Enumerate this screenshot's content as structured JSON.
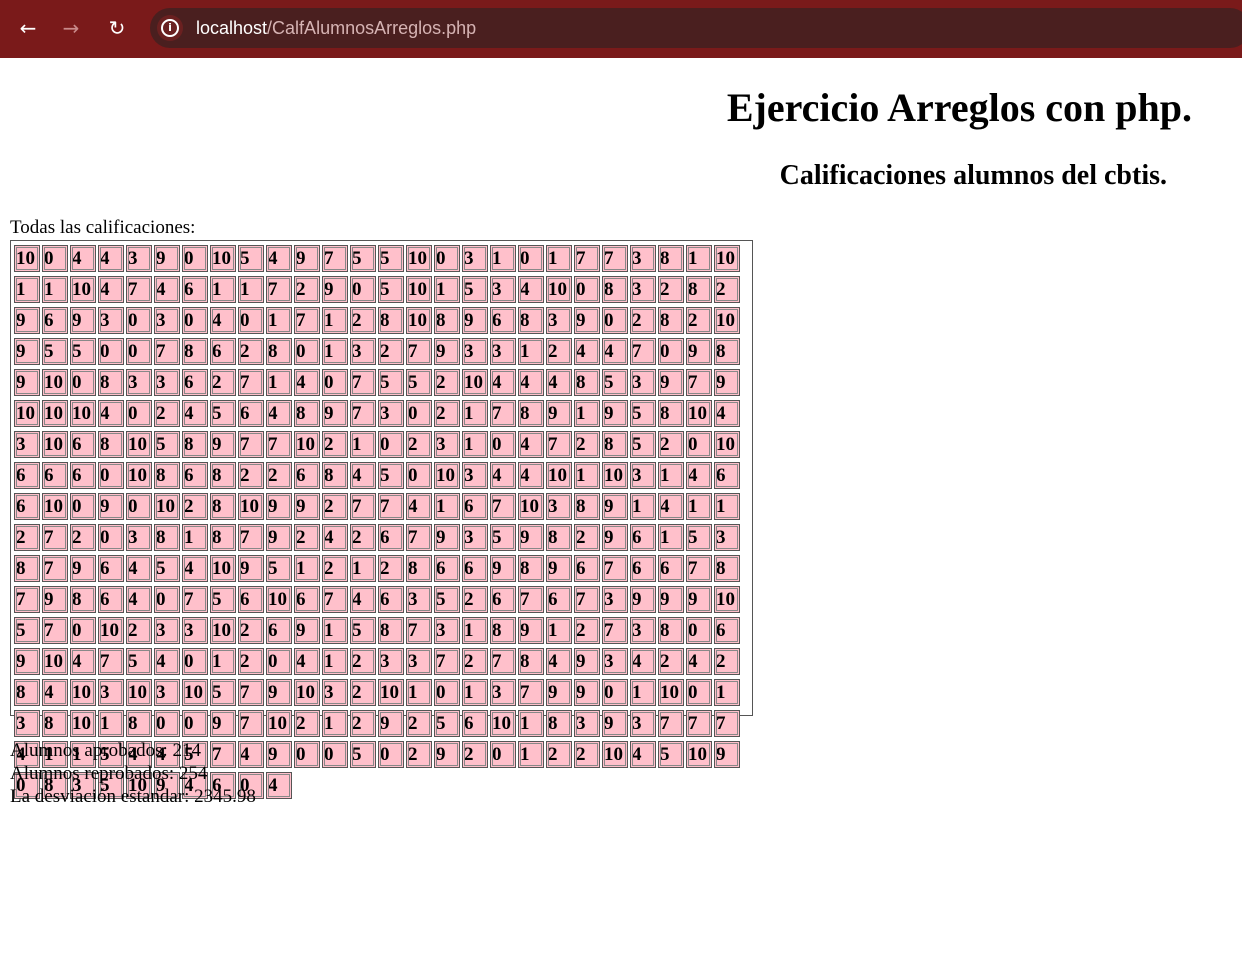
{
  "browser": {
    "url_host": "localhost",
    "url_path": "/CalfAlumnosArreglos.php"
  },
  "page": {
    "title": "Ejercicio Arreglos con php.",
    "subtitle": "Calificaciones alumnos del cbtis.",
    "grades_label": "Todas las calificaciones:",
    "grades": [
      "10",
      "0",
      "4",
      "4",
      "3",
      "9",
      "0",
      "10",
      "5",
      "4",
      "9",
      "7",
      "5",
      "5",
      "10",
      "0",
      "3",
      "1",
      "0",
      "1",
      "7",
      "7",
      "3",
      "8",
      "1",
      "10",
      "1",
      "1",
      "10",
      "4",
      "7",
      "4",
      "6",
      "1",
      "1",
      "7",
      "2",
      "9",
      "0",
      "5",
      "10",
      "1",
      "5",
      "3",
      "4",
      "10",
      "0",
      "8",
      "3",
      "2",
      "8",
      "2",
      "9",
      "6",
      "9",
      "3",
      "0",
      "3",
      "0",
      "4",
      "0",
      "1",
      "7",
      "1",
      "2",
      "8",
      "10",
      "8",
      "9",
      "6",
      "8",
      "3",
      "9",
      "0",
      "2",
      "8",
      "2",
      "10",
      "9",
      "5",
      "5",
      "0",
      "0",
      "7",
      "8",
      "6",
      "2",
      "8",
      "0",
      "1",
      "3",
      "2",
      "7",
      "9",
      "3",
      "3",
      "1",
      "2",
      "4",
      "4",
      "7",
      "0",
      "9",
      "8",
      "9",
      "10",
      "0",
      "8",
      "3",
      "3",
      "6",
      "2",
      "7",
      "1",
      "4",
      "0",
      "7",
      "5",
      "5",
      "2",
      "10",
      "4",
      "4",
      "4",
      "8",
      "5",
      "3",
      "9",
      "7",
      "9",
      "10",
      "10",
      "10",
      "4",
      "0",
      "2",
      "4",
      "5",
      "6",
      "4",
      "8",
      "9",
      "7",
      "3",
      "0",
      "2",
      "1",
      "7",
      "8",
      "9",
      "1",
      "9",
      "5",
      "8",
      "10",
      "4",
      "3",
      "10",
      "6",
      "8",
      "10",
      "5",
      "8",
      "9",
      "7",
      "7",
      "10",
      "2",
      "1",
      "0",
      "2",
      "3",
      "1",
      "0",
      "4",
      "7",
      "2",
      "8",
      "5",
      "2",
      "0",
      "10",
      "6",
      "6",
      "6",
      "0",
      "10",
      "8",
      "6",
      "8",
      "2",
      "2",
      "6",
      "8",
      "4",
      "5",
      "0",
      "10",
      "3",
      "4",
      "4",
      "10",
      "1",
      "10",
      "3",
      "1",
      "4",
      "6",
      "6",
      "10",
      "0",
      "9",
      "0",
      "10",
      "2",
      "8",
      "10",
      "9",
      "9",
      "2",
      "7",
      "7",
      "4",
      "1",
      "6",
      "7",
      "10",
      "3",
      "8",
      "9",
      "1",
      "4",
      "1",
      "1",
      "2",
      "7",
      "2",
      "0",
      "3",
      "8",
      "1",
      "8",
      "7",
      "9",
      "2",
      "4",
      "2",
      "6",
      "7",
      "9",
      "3",
      "5",
      "9",
      "8",
      "2",
      "9",
      "6",
      "1",
      "5",
      "3",
      "8",
      "7",
      "9",
      "6",
      "4",
      "5",
      "4",
      "10",
      "9",
      "5",
      "1",
      "2",
      "1",
      "2",
      "8",
      "6",
      "6",
      "9",
      "8",
      "9",
      "6",
      "7",
      "6",
      "6",
      "7",
      "8",
      "7",
      "9",
      "8",
      "6",
      "4",
      "0",
      "7",
      "5",
      "6",
      "10",
      "6",
      "7",
      "4",
      "6",
      "3",
      "5",
      "2",
      "6",
      "7",
      "6",
      "7",
      "3",
      "9",
      "9",
      "9",
      "10",
      "5",
      "7",
      "0",
      "10",
      "2",
      "3",
      "3",
      "10",
      "2",
      "6",
      "9",
      "1",
      "5",
      "8",
      "7",
      "3",
      "1",
      "8",
      "9",
      "1",
      "2",
      "7",
      "3",
      "8",
      "0",
      "6",
      "9",
      "10",
      "4",
      "7",
      "5",
      "4",
      "0",
      "1",
      "2",
      "0",
      "4",
      "1",
      "2",
      "3",
      "3",
      "7",
      "2",
      "7",
      "8",
      "4",
      "9",
      "3",
      "4",
      "2",
      "4",
      "2",
      "8",
      "4",
      "10",
      "3",
      "10",
      "3",
      "10",
      "5",
      "7",
      "9",
      "10",
      "3",
      "2",
      "10",
      "1",
      "0",
      "1",
      "3",
      "7",
      "9",
      "9",
      "0",
      "1",
      "10",
      "0",
      "1",
      "3",
      "8",
      "10",
      "1",
      "8",
      "0",
      "0",
      "9",
      "7",
      "10",
      "2",
      "1",
      "2",
      "9",
      "2",
      "5",
      "6",
      "10",
      "1",
      "8",
      "3",
      "9",
      "3",
      "7",
      "7",
      "7",
      "4",
      "1",
      "1",
      "5",
      "4",
      "4",
      "5",
      "7",
      "4",
      "9",
      "0",
      "0",
      "5",
      "0",
      "2",
      "9",
      "2",
      "0",
      "1",
      "2",
      "2",
      "10",
      "4",
      "5",
      "10",
      "9",
      "0",
      "8",
      "3",
      "5",
      "10",
      "9",
      "4",
      "6",
      "0",
      "4"
    ],
    "stats": {
      "approved": "Alumnos aprobados: 214",
      "failed": "Alumnos reprobados: 254",
      "stddev": "La desviación estandar: 2345.98"
    }
  }
}
